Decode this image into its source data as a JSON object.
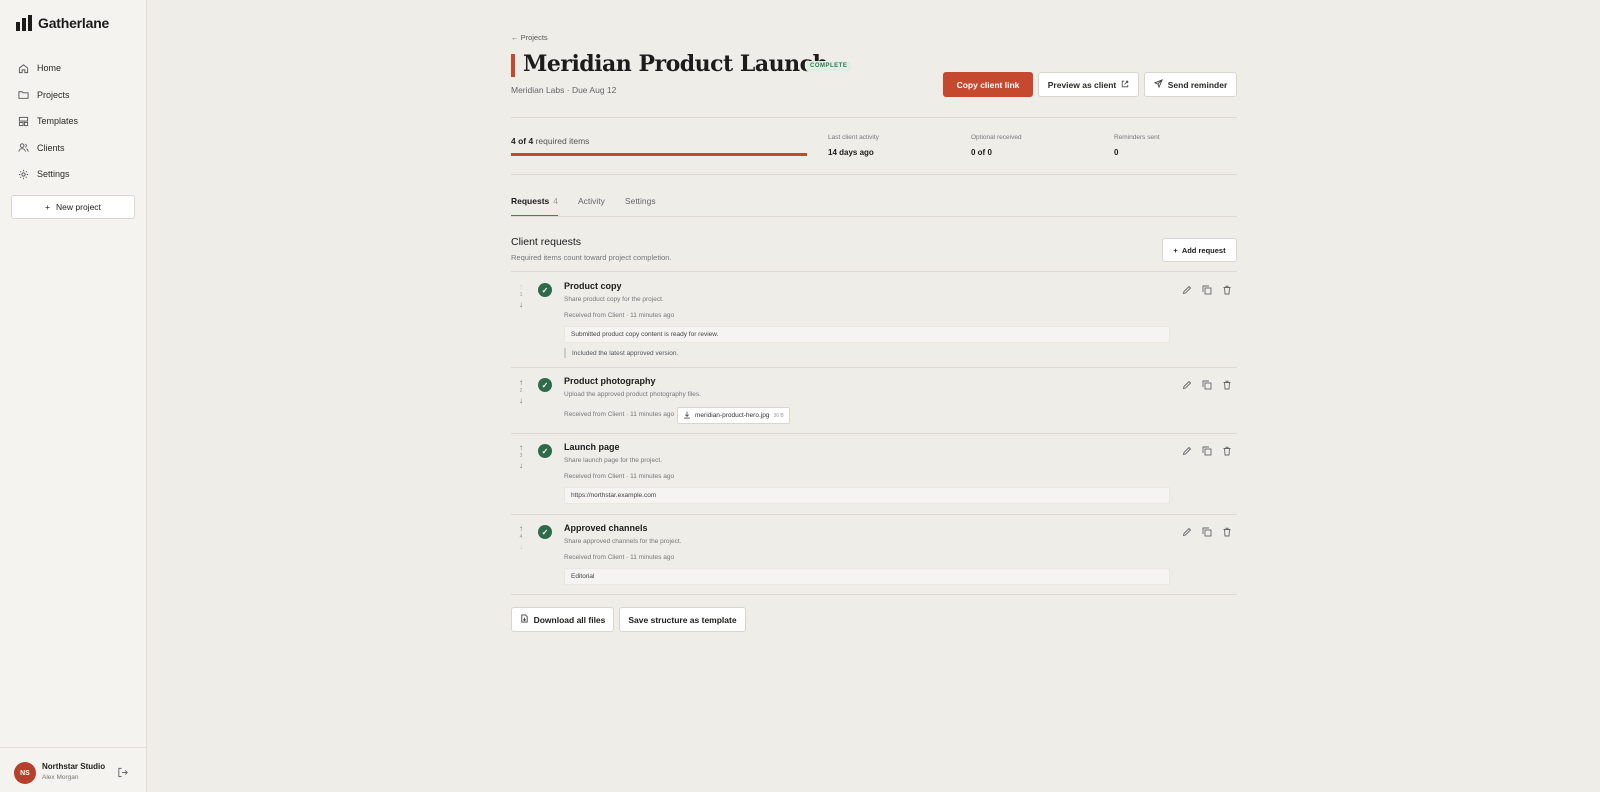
{
  "app": {
    "name": "Gatherlane"
  },
  "sidebar": {
    "items": [
      {
        "label": "Home",
        "icon": "home-icon"
      },
      {
        "label": "Projects",
        "icon": "folder-icon"
      },
      {
        "label": "Templates",
        "icon": "template-icon"
      },
      {
        "label": "Clients",
        "icon": "users-icon"
      },
      {
        "label": "Settings",
        "icon": "gear-icon"
      }
    ],
    "new_project": "New project",
    "org": {
      "initials": "NS",
      "name": "Northstar Studio",
      "user": "Alex Morgan"
    }
  },
  "header": {
    "back": "← Projects",
    "title": "Meridian Product Launch",
    "status": "COMPLETE",
    "subtitle": "Meridian Labs · Due Aug 12",
    "copy_link": "Copy client link",
    "preview": "Preview as client",
    "reminder": "Send reminder"
  },
  "progress": {
    "count": "4 of 4",
    "label": "required items",
    "fraction": 1.0
  },
  "stats": [
    {
      "label": "Last client activity",
      "value": "14 days ago"
    },
    {
      "label": "Optional received",
      "value": "0 of 0"
    },
    {
      "label": "Reminders sent",
      "value": "0"
    }
  ],
  "tabs": [
    {
      "label": "Requests",
      "count": "4"
    },
    {
      "label": "Activity",
      "count": ""
    },
    {
      "label": "Settings",
      "count": ""
    }
  ],
  "requests_section": {
    "title": "Client requests",
    "subtitle": "Required items count toward project completion.",
    "add": "Add request"
  },
  "requests": [
    {
      "num": "1",
      "title": "Product copy",
      "desc": "Share product copy for the project.",
      "meta": "Received from Client · 11 minutes ago",
      "box": "Submitted product copy content is ready for review.",
      "note": "Included the latest approved version."
    },
    {
      "num": "2",
      "title": "Product photography",
      "desc": "Upload the approved product photography files.",
      "meta": "Received from Client · 11 minutes ago",
      "file": "meridian-product-hero.jpg",
      "file_size": "36 B"
    },
    {
      "num": "3",
      "title": "Launch page",
      "desc": "Share launch page for the project.",
      "meta": "Received from Client · 11 minutes ago",
      "box": "https://northstar.example.com"
    },
    {
      "num": "4",
      "title": "Approved channels",
      "desc": "Share approved channels for the project.",
      "meta": "Received from Client · 11 minutes ago",
      "box": "Editorial"
    }
  ],
  "footer": {
    "download": "Download all files",
    "save_template": "Save structure as template"
  },
  "colors": {
    "accent": "#c5492f",
    "success": "#2e6b4a"
  }
}
